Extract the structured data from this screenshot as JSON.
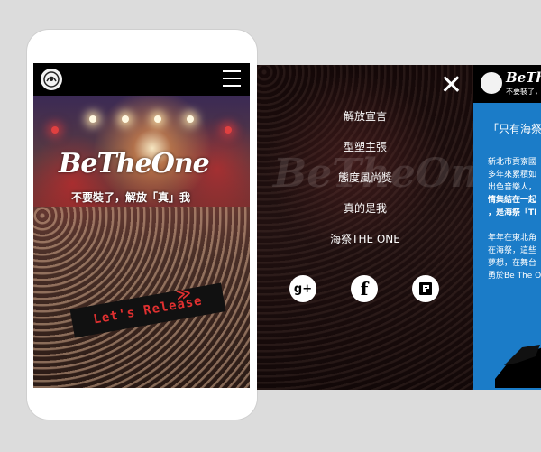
{
  "mobile_screen": {
    "brand_title": "BeTheOne",
    "brand_title_parts": [
      "Be",
      "The",
      "One"
    ],
    "slogan": "不要裝了，解放「真」我",
    "release_button": "Let's Release",
    "release_arrows": "≫",
    "menu_icon": "hamburger-menu-icon",
    "logo_icon": "festival-logo-icon"
  },
  "menu_panel": {
    "close_icon": "close-icon",
    "items": [
      {
        "label": "解放宣言"
      },
      {
        "label": "型塑主張"
      },
      {
        "label": "態度風尚獎"
      },
      {
        "label": "真的是我"
      },
      {
        "label": "海祭THE ONE"
      }
    ],
    "social": [
      {
        "name": "google-plus-icon",
        "glyph": "g+"
      },
      {
        "name": "facebook-icon",
        "glyph": "f"
      },
      {
        "name": "pixnet-icon",
        "glyph": "P"
      }
    ],
    "ghost_title": "BeTheOne"
  },
  "content_panel": {
    "brand": "BeThe",
    "subtitle": "不要裝了，解放",
    "quote": "「只有海祭",
    "paragraph1": [
      "新北市貢寮國",
      "多年來累積如",
      "出色音樂人，",
      "情集結在一起",
      "，是海祭「TI"
    ],
    "paragraph2": [
      "年年在東北角",
      "在海祭，這些",
      "夢想，在舞台",
      "勇於Be The O"
    ]
  },
  "colors": {
    "background": "#dcdcdc",
    "accent_red": "#e03030",
    "content_blue": "#1b7cc8",
    "black": "#000000"
  }
}
